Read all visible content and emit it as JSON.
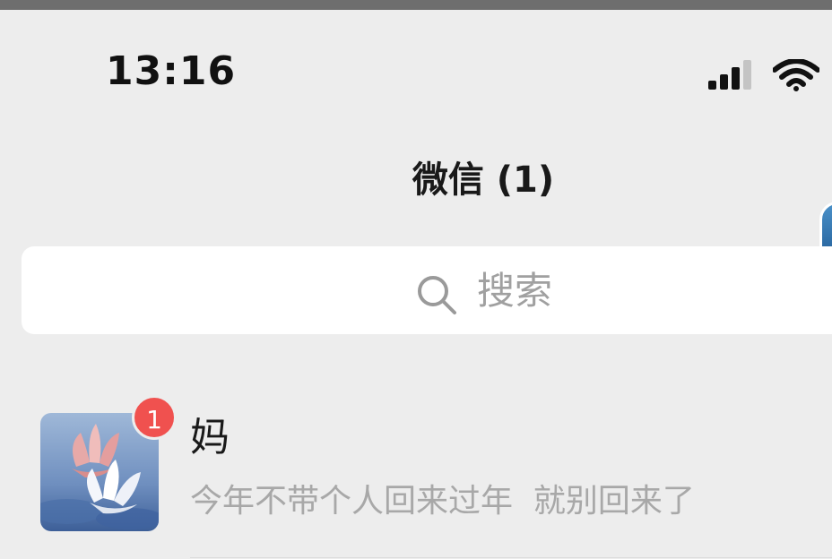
{
  "status_bar": {
    "time": "13:16",
    "icons": [
      "signal-icon",
      "wifi-icon"
    ]
  },
  "nav": {
    "title": "微信 (1)"
  },
  "search": {
    "placeholder": "搜索",
    "icon": "search-icon"
  },
  "chats": [
    {
      "name": "妈",
      "preview": "今年不带个人回来过年  就别回来了",
      "unread": "1",
      "avatar": "lotus-avatar"
    }
  ],
  "colors": {
    "background": "#ededed",
    "badge": "#f0514f",
    "search_bg": "#ffffff",
    "secondary_text": "#a8a8a8"
  }
}
